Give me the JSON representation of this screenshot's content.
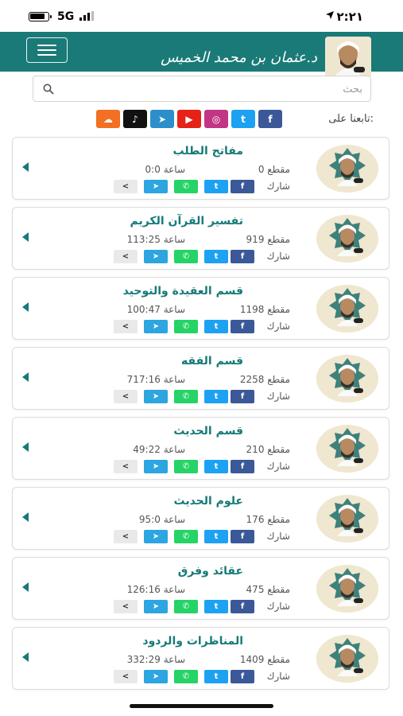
{
  "status_bar": {
    "time": "٢:٢١",
    "network": "5G"
  },
  "header": {
    "logo_text": "د.عثمان بن محمد الخميس"
  },
  "search": {
    "placeholder": "بحث"
  },
  "follow": {
    "label": "تابعنا على:"
  },
  "socials": [
    {
      "name": "facebook",
      "glyph": "f",
      "color": "#3b5998"
    },
    {
      "name": "twitter",
      "glyph": "t",
      "color": "#1da1f2"
    },
    {
      "name": "instagram",
      "glyph": "◎",
      "color": "#c13584"
    },
    {
      "name": "youtube",
      "glyph": "▶",
      "color": "#e62117"
    },
    {
      "name": "telegram",
      "glyph": "➤",
      "color": "#2c8fcc"
    },
    {
      "name": "tiktok",
      "glyph": "♪",
      "color": "#111111"
    },
    {
      "name": "soundcloud",
      "glyph": "☁",
      "color": "#f26f23"
    }
  ],
  "categories": [
    {
      "title": "مفاتح الطلب",
      "count": "0 مقطع",
      "duration": "0:0 ساعة"
    },
    {
      "title": "تفسير القرآن الكريم",
      "count": "919 مقطع",
      "duration": "113:25 ساعة"
    },
    {
      "title": "قسم العقيدة والتوحيد",
      "count": "1198 مقطع",
      "duration": "100:47 ساعة"
    },
    {
      "title": "قسم الفقه",
      "count": "2258 مقطع",
      "duration": "717:16 ساعة"
    },
    {
      "title": "قسم الحديث",
      "count": "210 مقطع",
      "duration": "49:22 ساعة"
    },
    {
      "title": "علوم الحديث",
      "count": "176 مقطع",
      "duration": "95:0 ساعة"
    },
    {
      "title": "عقائد وفرق",
      "count": "475 مقطع",
      "duration": "126:16 ساعة"
    },
    {
      "title": "المناظرات والردود",
      "count": "1409 مقطع",
      "duration": "332:29 ساعة"
    }
  ],
  "share": {
    "label": "شارك",
    "buttons": [
      {
        "name": "facebook",
        "glyph": "f",
        "color": "#3b5998"
      },
      {
        "name": "twitter",
        "glyph": "t",
        "color": "#1da1f2"
      },
      {
        "name": "whatsapp",
        "glyph": "✆",
        "color": "#25d366"
      },
      {
        "name": "telegram",
        "glyph": "➤",
        "color": "#2ca5e0"
      },
      {
        "name": "share",
        "glyph": "<",
        "color": "#e9e9e9"
      }
    ]
  },
  "colors": {
    "primary": "#1a7a78",
    "title_text": "#167a77"
  }
}
